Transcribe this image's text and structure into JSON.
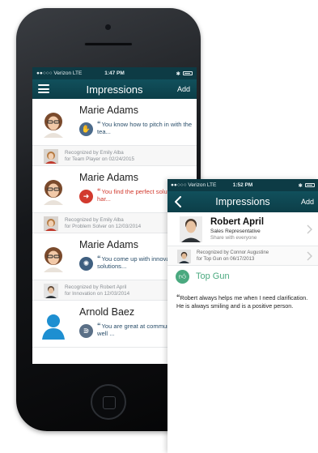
{
  "phone_list": {
    "status": {
      "carrier": "●●○○○ Verizon  LTE",
      "time": "1:47 PM",
      "bluetooth": "✱"
    },
    "nav": {
      "title": "Impressions",
      "add_label": "Add"
    },
    "items": [
      {
        "name": "Marie Adams",
        "quote_mark": "“",
        "quote": "You know how to pitch in with the tea...",
        "badge_color": "#4b6a8a",
        "badge_icon": "handshake-icon",
        "recognized_by": "Recognized by Emily Alba",
        "recognized_for": "for Team Player on 02/24/2015"
      },
      {
        "name": "Marie Adams",
        "quote_mark": "“",
        "quote": "You find the perfect solution for har...",
        "badge_color": "#d23a2e",
        "badge_icon": "arrow-down-icon",
        "recognized_by": "Recognized by Emily Alba",
        "recognized_for": "for Problem Solver on 12/03/2014"
      },
      {
        "name": "Marie Adams",
        "quote_mark": "“",
        "quote": "You come up with innovative solutions...",
        "badge_color": "#3f5f80",
        "badge_icon": "lightbulb-icon",
        "recognized_by": "Recognized by Robert April",
        "recognized_for": "for Innovation on 12/03/2014"
      },
      {
        "name": "Arnold Baez",
        "quote_mark": "“",
        "quote": "You are great at communicating, well ...",
        "badge_color": "#5a6f86",
        "badge_icon": "signal-icon"
      }
    ]
  },
  "phone_detail": {
    "status": {
      "carrier": "●●○○○ Verizon  LTE",
      "time": "1:52 PM",
      "bluetooth": "✱"
    },
    "nav": {
      "title": "Impressions",
      "add_label": "Add"
    },
    "profile": {
      "name": "Robert April",
      "role": "Sales Representative",
      "share": "Share with everyone"
    },
    "recognition": {
      "by": "Recognized by Connor Augustine",
      "for": "for Top Gun on 06/17/2013"
    },
    "award": {
      "name": "Top Gun",
      "color": "#4aa97f",
      "icon": "thumbs-up-icon"
    },
    "message": {
      "quote_mark": "“",
      "text": "Robert always helps me when I need clarification. He is always smiling and is a positive person."
    }
  }
}
